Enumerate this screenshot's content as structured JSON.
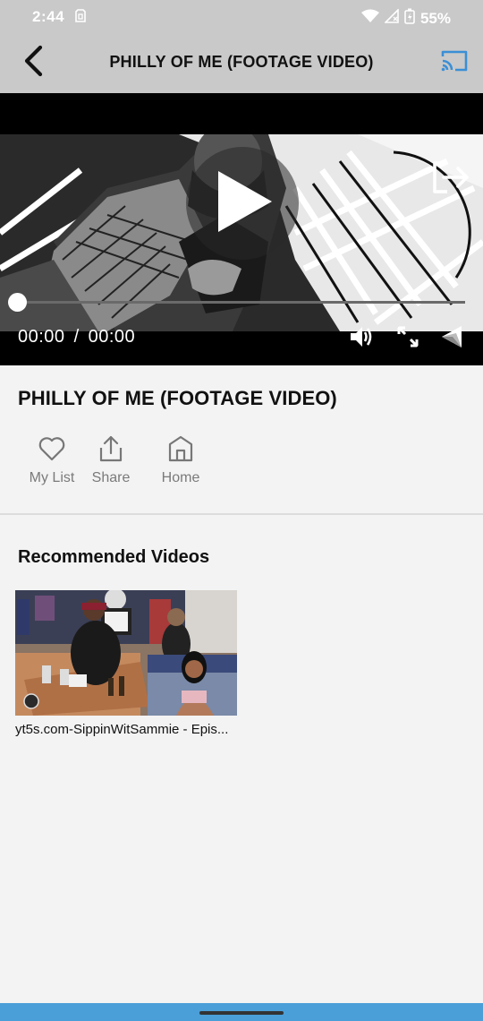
{
  "status_bar": {
    "time": "2:44",
    "battery": "55%"
  },
  "app_bar": {
    "title": "PHILLY OF ME (FOOTAGE VIDEO)",
    "back_icon": "chevron-left-icon",
    "cast_icon": "cast-icon",
    "cast_color": "#3b8fd6"
  },
  "player": {
    "current_time": "00:00",
    "separator": "/",
    "duration": "00:00",
    "progress": 0,
    "controls": [
      "volume-icon",
      "fullscreen-icon",
      "quality-icon"
    ]
  },
  "video": {
    "title": "PHILLY OF ME (FOOTAGE VIDEO)",
    "actions": [
      {
        "label": "My List",
        "icon": "heart-icon"
      },
      {
        "label": "Share",
        "icon": "share-icon"
      },
      {
        "label": "Home",
        "icon": "home-icon"
      }
    ]
  },
  "recommended": {
    "heading": "Recommended Videos",
    "items": [
      {
        "title": "yt5s.com-SippinWitSammie - Epis..."
      }
    ]
  },
  "nav_bar": {
    "color": "#4a9fd8"
  }
}
